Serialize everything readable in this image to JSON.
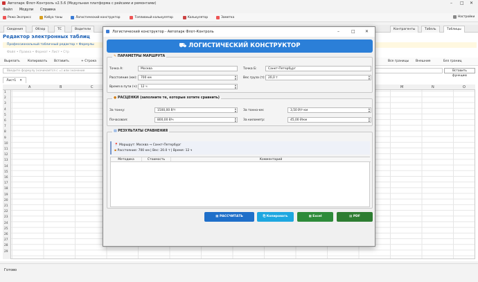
{
  "app": {
    "title": "Автопарк Флот-Контроль v2.5.6 (Модульная платформа с рейсами и ремонтами)",
    "menu": [
      "Файл",
      "Модули",
      "Справка"
    ]
  },
  "toolbar": [
    "Режо Экспресс",
    "Кабуа таны",
    "Логистический конструктор",
    "Топливный калькулятор",
    "Калькулятор",
    "Заметка"
  ],
  "toolbar_right": "Настройки",
  "tabs": [
    "Сведения",
    "Обзор",
    "ТС",
    "Водители",
    "Контрагенты",
    "Табель",
    "Таблицы"
  ],
  "editor": {
    "title": "Редактор электронных таблиц",
    "subtitle": "Профессиональный табличный редактор • Формулы",
    "menu": "Файл • Правка • Формат • Лист • Стр",
    "ribbon_left": [
      "Вырезать",
      "Копировать",
      "Вставить",
      "+ Строка"
    ],
    "ribbon_right": [
      "Все границы",
      "Внешние",
      "Без границ"
    ],
    "formula_placeholder": "Введите формулу (начинается с =) или значение",
    "insert_function": "Вставить функцию",
    "sheet_tab": "Лист1",
    "columns": [
      "A",
      "B",
      "C",
      "M",
      "N",
      "O"
    ],
    "rows": [
      "1",
      "2",
      "3",
      "4",
      "5",
      "6",
      "7",
      "8",
      "9",
      "10",
      "11",
      "12",
      "13",
      "14",
      "15",
      "16",
      "17",
      "18",
      "19",
      "20",
      "21",
      "22",
      "23",
      "24",
      "25",
      "26",
      "27",
      "28",
      "29"
    ],
    "status": "Готово"
  },
  "dialog": {
    "window_title": "Логистический конструктор - Автопарк Флот-Контроль",
    "banner": "ЛОГИСТИЧЕСКИЙ КОНСТРУКТОР",
    "params": {
      "title": "ПАРАМЕТРЫ МАРШРУТА",
      "from_label": "Точка А:",
      "from_value": "Москва",
      "to_label": "Точка Б:",
      "to_value": "Санкт-Петербург",
      "distance_label": "Расстояние (км):",
      "distance_value": "700 км",
      "weight_label": "Вес груза (т):",
      "weight_value": "20,0 т",
      "time_label": "Время в пути (ч):",
      "time_value": "12 ч"
    },
    "rates": {
      "title": "РАСЦЕНКИ (заполните те, которые хотите сравнить)",
      "per_ton_label": "За тонну:",
      "per_ton_value": "1500,00 ₽/т",
      "per_tkm_label": "За тонно-км:",
      "per_tkm_value": "3,50 ₽/т·км",
      "hourly_label": "Почасовая:",
      "hourly_value": "800,00 ₽/ч",
      "per_km_label": "За километр:",
      "per_km_value": "45,00 ₽/км"
    },
    "results": {
      "title": "РЕЗУЛЬТАТЫ СРАВНЕНИЯ",
      "route": "Маршрут: Москва → Санкт-Петербург",
      "summary": "Расстояние: 700 км  |  Вес: 20.0 т  |  Время: 12 ч",
      "columns": [
        "Методика",
        "Стоимость",
        "Комментарий"
      ]
    },
    "buttons": {
      "calculate": "РАССЧИТАТЬ",
      "copy": "Копировать",
      "excel": "Excel",
      "pdf": "PDF"
    }
  },
  "colors": {
    "primary": "#2b7fd8",
    "calc": "#1f6fc9",
    "copy": "#1ea7e0",
    "excel": "#2e8b3a",
    "pdf": "#2e7d32"
  }
}
